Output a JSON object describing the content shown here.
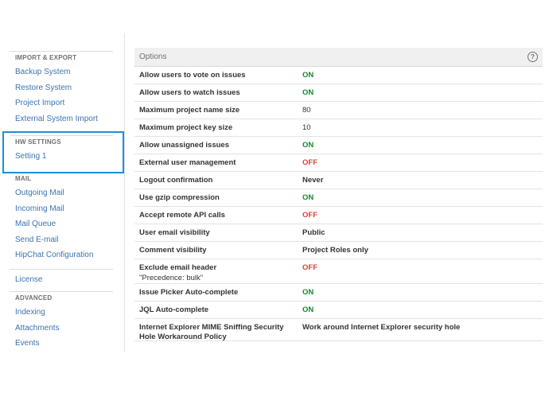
{
  "sidebar": {
    "groups": [
      {
        "heading": "IMPORT & EXPORT",
        "links": [
          "Backup System",
          "Restore System",
          "Project Import",
          "External System Import"
        ]
      },
      {
        "heading": "HW SETTINGS",
        "links": [
          "Setting 1"
        ]
      },
      {
        "heading": "MAIL",
        "links": [
          "Outgoing Mail",
          "Incoming Mail",
          "Mail Queue",
          "Send E-mail",
          "HipChat Configuration"
        ]
      },
      {
        "heading": "",
        "links": [
          "License"
        ]
      },
      {
        "heading": "ADVANCED",
        "links": [
          "Indexing",
          "Attachments",
          "Events"
        ]
      }
    ]
  },
  "panel": {
    "title": "Options",
    "help_icon": "question-circle-icon"
  },
  "options": [
    {
      "label": "Allow users to vote on issues",
      "value": "ON",
      "status": "on"
    },
    {
      "label": "Allow users to watch issues",
      "value": "ON",
      "status": "on"
    },
    {
      "label": "Maximum project name size",
      "value": "80",
      "status": "plain"
    },
    {
      "label": "Maximum project key size",
      "value": "10",
      "status": "plain"
    },
    {
      "label": "Allow unassigned issues",
      "value": "ON",
      "status": "on"
    },
    {
      "label": "External user management",
      "value": "OFF",
      "status": "off"
    },
    {
      "label": "Logout confirmation",
      "value": "Never",
      "status": "text"
    },
    {
      "label": "Use gzip compression",
      "value": "ON",
      "status": "on"
    },
    {
      "label": "Accept remote API calls",
      "value": "OFF",
      "status": "off"
    },
    {
      "label": "User email visibility",
      "value": "Public",
      "status": "text"
    },
    {
      "label": "Comment visibility",
      "value": "Project Roles only",
      "status": "text"
    },
    {
      "label": "Exclude email header",
      "sub": "\"Precedence: bulk\"",
      "value": "OFF",
      "status": "off"
    },
    {
      "label": "Issue Picker Auto-complete",
      "value": "ON",
      "status": "on"
    },
    {
      "label": "JQL Auto-complete",
      "value": "ON",
      "status": "on"
    },
    {
      "label": "Internet Explorer MIME Sniffing Security Hole Workaround Policy",
      "value": "Work around Internet Explorer security hole",
      "status": "text"
    }
  ],
  "colors": {
    "on": "#14892c",
    "off": "#d04437",
    "link": "#3b73af",
    "highlight": "#1b8fd9"
  }
}
